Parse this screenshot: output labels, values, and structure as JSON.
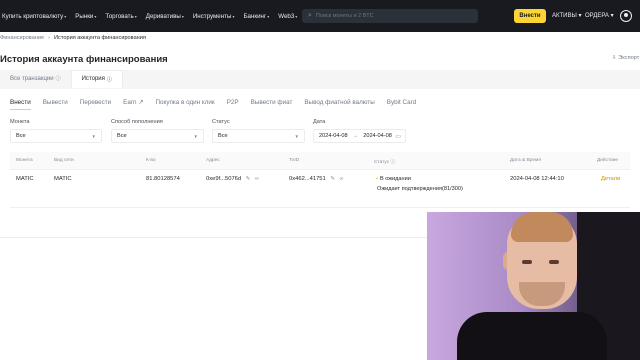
{
  "nav": {
    "items": [
      {
        "label": "Купить криптовалюту",
        "caret": "▾"
      },
      {
        "label": "Рынки",
        "caret": "▾"
      },
      {
        "label": "Торговать",
        "caret": "▾"
      },
      {
        "label": "Деривативы",
        "caret": "▾"
      },
      {
        "label": "Инструменты",
        "caret": "▾"
      },
      {
        "label": "Банкинг",
        "caret": "▾"
      },
      {
        "label": "Web3",
        "caret": "▾"
      }
    ],
    "search_placeholder": "Поиск монеты и 2 BTC",
    "deposit_label": "Внести",
    "assets_label": "АКТИВЫ ▾",
    "orders_label": "ОРДЕРА ▾",
    "icons": {
      "search": "search-icon",
      "profile": "user-icon"
    }
  },
  "breadcrumb": {
    "parent": "Финансирование",
    "separator": "›",
    "current": "История аккаунта финансирования"
  },
  "page_title": "История аккаунта финансирования",
  "export_label": "Экспорт",
  "main_tabs": [
    {
      "label": "Все транзакции",
      "info": "ⓘ"
    },
    {
      "label": "История",
      "info": "ⓘ"
    }
  ],
  "sub_tabs": [
    {
      "label": "Внести"
    },
    {
      "label": "Вывести"
    },
    {
      "label": "Перевести"
    },
    {
      "label": "Earn ↗"
    },
    {
      "label": "Покупка в один клик"
    },
    {
      "label": "P2P"
    },
    {
      "label": "Вывести фиат"
    },
    {
      "label": "Вывод фиатной валюты"
    },
    {
      "label": "Bybit Card"
    }
  ],
  "filters": {
    "coin": {
      "label": "Монета",
      "value": "Все"
    },
    "method": {
      "label": "Способ пополнения",
      "value": "Все"
    },
    "status": {
      "label": "Статус",
      "value": "Все"
    },
    "date": {
      "label": "Дата",
      "from": "2024-04-08",
      "to": "2024-04-08",
      "arrow": "→"
    }
  },
  "table": {
    "headers": {
      "coin": "Монета",
      "chain": "Вид сети",
      "amount": "К-во",
      "address": "Адрес",
      "txid": "TxID",
      "status": "Статус ⓘ",
      "datetime": "Дата & Время",
      "action": "Действие"
    },
    "rows": [
      {
        "coin": "MATIC",
        "chain": "MATIC",
        "amount": "81.80128574",
        "address": "0xe9f...5076d",
        "txid": "0x462...41751",
        "status": "В ожидании",
        "status_sub": "Ожидает подтверждения(81/300)",
        "datetime": "2024-04-08 12:44:10",
        "action": "Детали"
      }
    ]
  },
  "colors": {
    "accent": "#fcd535",
    "nav_bg": "#181a20",
    "link": "#c99400"
  }
}
